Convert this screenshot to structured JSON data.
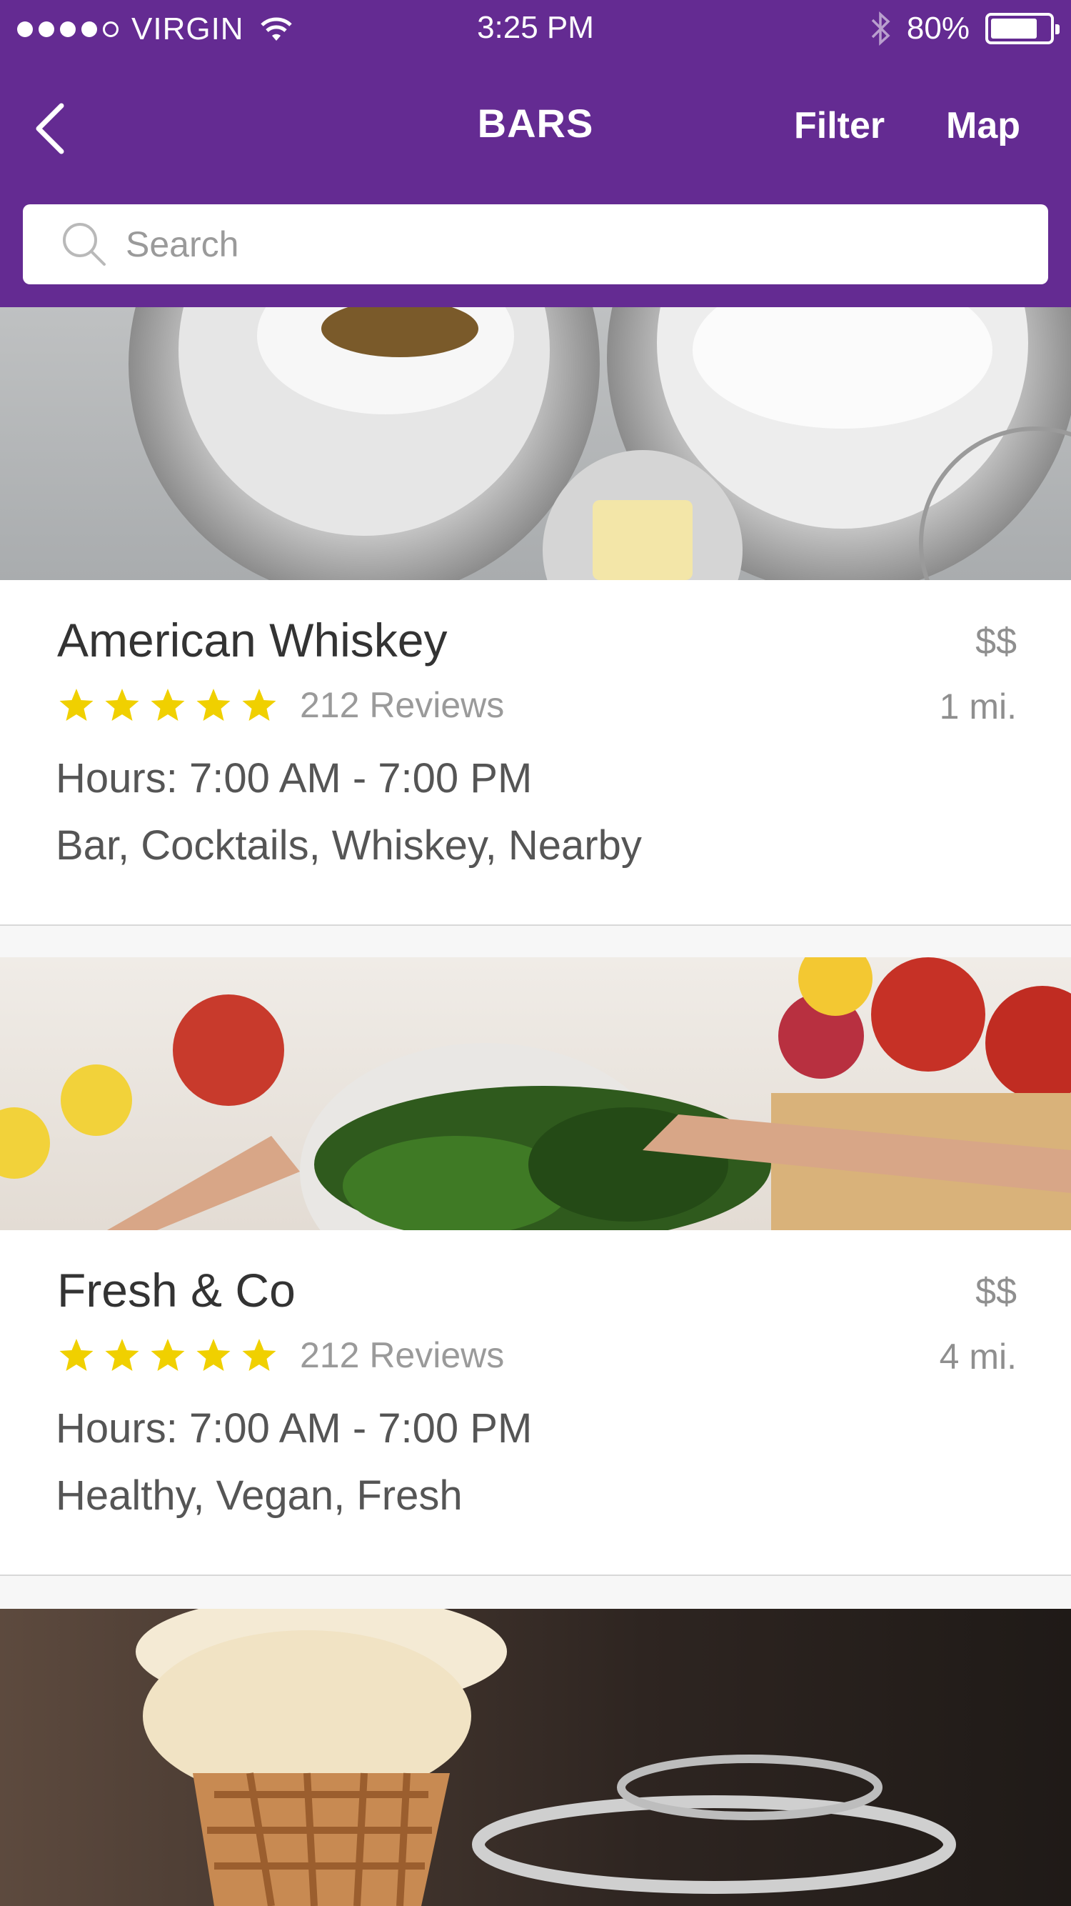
{
  "status_bar": {
    "carrier": "VIRGIN",
    "time": "3:25 PM",
    "battery_percent": "80%",
    "battery_level": 0.8,
    "icons": [
      "signal-dots-icon",
      "wifi-icon",
      "bluetooth-icon",
      "battery-icon"
    ]
  },
  "nav": {
    "title": "BARS",
    "filter_label": "Filter",
    "map_label": "Map",
    "back_icon": "chevron-left-icon"
  },
  "search": {
    "placeholder": "Search",
    "icon": "search-icon"
  },
  "listings": [
    {
      "name": "American Whiskey",
      "price": "$$",
      "rating": 5,
      "reviews": "212 Reviews",
      "distance": "1 mi.",
      "hours": "Hours: 7:00 AM - 7:00 PM",
      "tags": "Bar, Cocktails, Whiskey, Nearby",
      "image": "baking-bowls-photo"
    },
    {
      "name": "Fresh & Co",
      "price": "$$",
      "rating": 5,
      "reviews": "212 Reviews",
      "distance": "4 mi.",
      "hours": "Hours: 7:00 AM - 7:00 PM",
      "tags": "Healthy, Vegan, Fresh",
      "image": "kale-salad-photo"
    },
    {
      "image": "ice-cream-cone-photo"
    }
  ],
  "colors": {
    "header": "#642b92",
    "star": "#f0d000",
    "text_dark": "#333333",
    "text_muted": "#8f8f8f"
  }
}
